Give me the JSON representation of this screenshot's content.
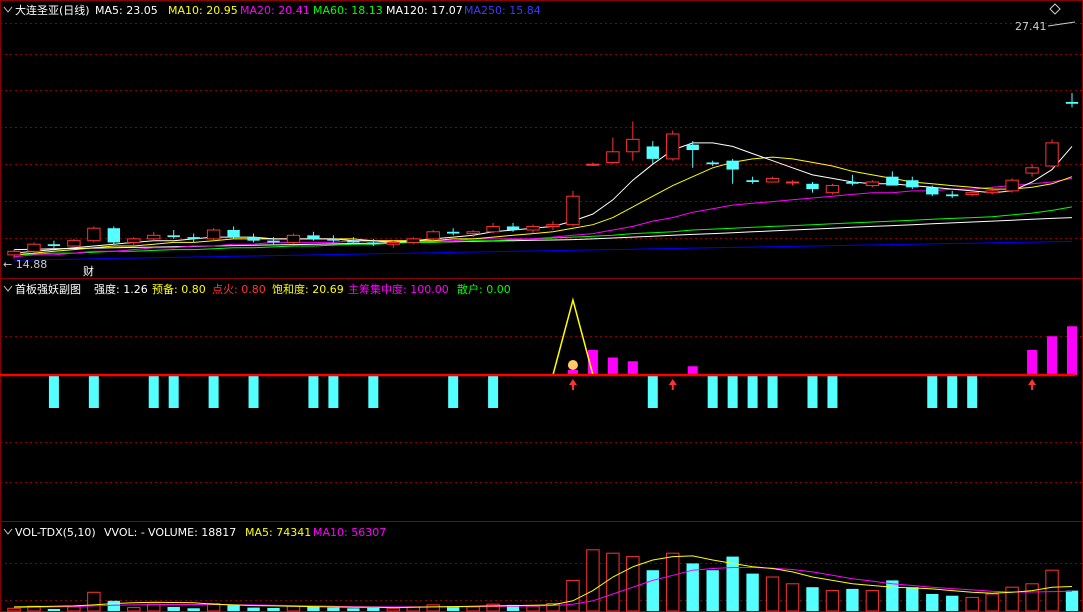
{
  "panel_main": {
    "title": "大连圣亚(日线)",
    "ma_items": [
      {
        "label": "MA5: 23.05",
        "color": "#ffffff"
      },
      {
        "label": "MA10: 20.95",
        "color": "#ffff00"
      },
      {
        "label": "MA20: 20.41",
        "color": "#ff00ff"
      },
      {
        "label": "MA60: 18.13",
        "color": "#00ff00"
      },
      {
        "label": "MA120: 17.07",
        "color": "#ffffff"
      },
      {
        "label": "MA250: 15.84",
        "color": "#0000ff"
      }
    ],
    "high_label": "27.41",
    "low_label": "← 14.88",
    "marker": "财"
  },
  "panel_indicator": {
    "title": "首板强妖副图",
    "items": [
      {
        "label": "强度: 1.26",
        "color": "#ffffff"
      },
      {
        "label": "预备: 0.80",
        "color": "#ffff00"
      },
      {
        "label": "点火: 0.80",
        "color": "#ff3333"
      },
      {
        "label": "饱和度: 20.69",
        "color": "#ffff00"
      },
      {
        "label": "主筹集中度: 100.00",
        "color": "#ff00ff"
      },
      {
        "label": "散户: 0.00",
        "color": "#00ff00"
      }
    ]
  },
  "panel_volume": {
    "title": "VOL-TDX(5,10)",
    "items": [
      {
        "label": "VVOL: -",
        "color": "#ffffff"
      },
      {
        "label": "VOLUME: 18817",
        "color": "#ffffff"
      },
      {
        "label": "MA5: 74341",
        "color": "#ffff00"
      },
      {
        "label": "MA10: 56307",
        "color": "#ff00ff"
      }
    ]
  },
  "colors": {
    "up": "#ff3232",
    "down": "#54ffff",
    "grid": "#8b0000",
    "ma5": "#ffffff",
    "ma10": "#ffff00",
    "ma20": "#ff00ff",
    "ma60": "#00ff00",
    "ma120": "#ffffff",
    "ma250": "#0000ff"
  },
  "chart_data": {
    "type": "candlestick",
    "price_range": [
      14.5,
      28.0
    ],
    "candles": [
      [
        14.9,
        15.2,
        14.7,
        15.1
      ],
      [
        15.1,
        15.6,
        15.0,
        15.5
      ],
      [
        15.5,
        15.7,
        15.3,
        15.4
      ],
      [
        15.4,
        15.8,
        15.3,
        15.7
      ],
      [
        15.7,
        16.5,
        15.6,
        16.4
      ],
      [
        16.4,
        16.5,
        15.5,
        15.6
      ],
      [
        15.6,
        15.9,
        15.4,
        15.8
      ],
      [
        15.8,
        16.2,
        15.7,
        16.0
      ],
      [
        16.0,
        16.3,
        15.8,
        15.9
      ],
      [
        15.9,
        16.1,
        15.6,
        15.8
      ],
      [
        15.8,
        16.4,
        15.7,
        16.3
      ],
      [
        16.3,
        16.5,
        15.8,
        15.9
      ],
      [
        15.9,
        16.1,
        15.6,
        15.7
      ],
      [
        15.7,
        15.9,
        15.5,
        15.6
      ],
      [
        15.6,
        16.1,
        15.5,
        16.0
      ],
      [
        16.0,
        16.2,
        15.7,
        15.8
      ],
      [
        15.8,
        16.0,
        15.6,
        15.7
      ],
      [
        15.7,
        15.9,
        15.5,
        15.6
      ],
      [
        15.6,
        15.8,
        15.4,
        15.5
      ],
      [
        15.5,
        15.7,
        15.3,
        15.6
      ],
      [
        15.6,
        15.9,
        15.5,
        15.8
      ],
      [
        15.8,
        16.3,
        15.7,
        16.2
      ],
      [
        16.2,
        16.4,
        16.0,
        16.1
      ],
      [
        16.1,
        16.3,
        15.9,
        16.2
      ],
      [
        16.2,
        16.7,
        16.1,
        16.5
      ],
      [
        16.5,
        16.7,
        16.2,
        16.3
      ],
      [
        16.3,
        16.6,
        16.1,
        16.5
      ],
      [
        16.5,
        16.8,
        16.3,
        16.6
      ],
      [
        16.6,
        18.5,
        16.5,
        18.2
      ],
      [
        20.0,
        20.1,
        19.9,
        20.0
      ],
      [
        20.1,
        21.5,
        20.0,
        20.7
      ],
      [
        20.7,
        22.4,
        20.2,
        21.4
      ],
      [
        21.0,
        21.3,
        20.0,
        20.3
      ],
      [
        20.3,
        21.9,
        20.2,
        21.7
      ],
      [
        21.1,
        21.3,
        19.8,
        20.8
      ],
      [
        20.1,
        20.2,
        19.9,
        20.0
      ],
      [
        20.2,
        20.3,
        18.9,
        19.7
      ],
      [
        19.1,
        19.3,
        18.9,
        19.0
      ],
      [
        19.0,
        19.3,
        19.0,
        19.2
      ],
      [
        19.0,
        19.1,
        18.8,
        19.0
      ],
      [
        18.9,
        19.0,
        18.4,
        18.6
      ],
      [
        18.4,
        18.9,
        18.3,
        18.8
      ],
      [
        19.0,
        19.4,
        18.8,
        18.9
      ],
      [
        18.8,
        19.1,
        18.7,
        19.0
      ],
      [
        19.3,
        19.6,
        18.8,
        18.8
      ],
      [
        19.1,
        19.3,
        18.6,
        18.7
      ],
      [
        18.7,
        18.8,
        18.2,
        18.3
      ],
      [
        18.3,
        18.5,
        18.1,
        18.2
      ],
      [
        18.3,
        18.4,
        18.2,
        18.4
      ],
      [
        18.4,
        18.7,
        18.3,
        18.5
      ],
      [
        18.5,
        19.2,
        18.4,
        19.1
      ],
      [
        19.5,
        20.0,
        19.3,
        19.8
      ],
      [
        19.9,
        21.4,
        19.8,
        21.2
      ],
      [
        23.5,
        24.0,
        23.2,
        23.4
      ]
    ],
    "ma5": [
      15.0,
      15.1,
      15.2,
      15.3,
      15.4,
      15.5,
      15.6,
      15.7,
      15.7,
      15.8,
      15.9,
      15.9,
      15.9,
      15.8,
      15.8,
      15.8,
      15.8,
      15.7,
      15.7,
      15.6,
      15.7,
      15.8,
      15.9,
      16.0,
      16.2,
      16.3,
      16.4,
      16.5,
      16.8,
      17.2,
      18.0,
      19.1,
      20.0,
      20.8,
      21.2,
      21.2,
      21.0,
      20.6,
      20.2,
      19.8,
      19.4,
      19.2,
      19.0,
      18.9,
      18.9,
      18.8,
      18.7,
      18.6,
      18.5,
      18.4,
      18.5,
      19.0,
      19.7,
      21.0
    ],
    "ma10": [
      14.9,
      15.0,
      15.1,
      15.2,
      15.3,
      15.4,
      15.4,
      15.5,
      15.6,
      15.6,
      15.7,
      15.8,
      15.8,
      15.8,
      15.8,
      15.8,
      15.8,
      15.8,
      15.7,
      15.7,
      15.7,
      15.7,
      15.8,
      15.8,
      15.9,
      16.0,
      16.1,
      16.2,
      16.4,
      16.6,
      17.0,
      17.6,
      18.2,
      18.8,
      19.3,
      19.8,
      20.1,
      20.3,
      20.4,
      20.3,
      20.1,
      19.9,
      19.6,
      19.4,
      19.2,
      19.0,
      18.9,
      18.8,
      18.7,
      18.6,
      18.6,
      18.7,
      18.9,
      19.3
    ],
    "ma20": [
      14.8,
      14.9,
      14.9,
      15.0,
      15.1,
      15.1,
      15.2,
      15.3,
      15.3,
      15.4,
      15.4,
      15.5,
      15.5,
      15.6,
      15.6,
      15.6,
      15.6,
      15.7,
      15.7,
      15.7,
      15.7,
      15.7,
      15.7,
      15.8,
      15.8,
      15.8,
      15.8,
      15.9,
      16.0,
      16.1,
      16.3,
      16.5,
      16.8,
      17.0,
      17.3,
      17.5,
      17.7,
      17.8,
      17.9,
      18.0,
      18.1,
      18.2,
      18.3,
      18.4,
      18.4,
      18.5,
      18.5,
      18.6,
      18.6,
      18.7,
      18.8,
      18.9,
      19.0,
      19.2
    ],
    "ma60": [
      14.9,
      14.95,
      15.0,
      15.0,
      15.05,
      15.1,
      15.1,
      15.15,
      15.2,
      15.2,
      15.25,
      15.3,
      15.3,
      15.35,
      15.4,
      15.4,
      15.45,
      15.5,
      15.5,
      15.55,
      15.6,
      15.6,
      15.65,
      15.7,
      15.7,
      15.75,
      15.8,
      15.85,
      15.9,
      15.95,
      16.0,
      16.1,
      16.15,
      16.2,
      16.3,
      16.35,
      16.4,
      16.45,
      16.5,
      16.55,
      16.6,
      16.65,
      16.7,
      16.75,
      16.8,
      16.85,
      16.9,
      16.95,
      17.0,
      17.05,
      17.15,
      17.25,
      17.4,
      17.6
    ],
    "ma120": [
      15.2,
      15.22,
      15.24,
      15.26,
      15.28,
      15.3,
      15.32,
      15.34,
      15.36,
      15.38,
      15.4,
      15.42,
      15.44,
      15.46,
      15.48,
      15.5,
      15.52,
      15.54,
      15.56,
      15.58,
      15.6,
      15.62,
      15.64,
      15.66,
      15.68,
      15.7,
      15.72,
      15.74,
      15.76,
      15.8,
      15.85,
      15.9,
      15.95,
      16.0,
      16.05,
      16.1,
      16.15,
      16.2,
      16.25,
      16.3,
      16.35,
      16.4,
      16.45,
      16.5,
      16.55,
      16.6,
      16.65,
      16.7,
      16.75,
      16.8,
      16.85,
      16.9,
      16.95,
      17.0
    ],
    "ma250": [
      14.6,
      14.62,
      14.64,
      14.66,
      14.68,
      14.7,
      14.72,
      14.74,
      14.76,
      14.78,
      14.8,
      14.82,
      14.84,
      14.86,
      14.88,
      14.9,
      14.92,
      14.94,
      14.96,
      14.98,
      15.0,
      15.02,
      15.04,
      15.06,
      15.08,
      15.1,
      15.12,
      15.14,
      15.16,
      15.18,
      15.2,
      15.22,
      15.24,
      15.26,
      15.28,
      15.3,
      15.32,
      15.34,
      15.36,
      15.38,
      15.4,
      15.42,
      15.44,
      15.46,
      15.48,
      15.5,
      15.52,
      15.54,
      15.56,
      15.58,
      15.6,
      15.62,
      15.64,
      15.66
    ],
    "indicator_bars": [
      0,
      0,
      -1,
      0,
      -1,
      0,
      0,
      -1,
      -1,
      0,
      -1,
      0,
      -1,
      0,
      0,
      -1,
      -1,
      0,
      -1,
      0,
      0,
      0,
      -1,
      0,
      -1,
      0,
      0,
      0,
      0.2,
      1.0,
      0.7,
      0.55,
      -1,
      0,
      0.35,
      -1,
      -1,
      -1,
      -1,
      0,
      -1,
      -1,
      0,
      0,
      0,
      0,
      -1,
      -1,
      -1,
      0,
      0,
      1.0,
      1.55,
      1.95
    ],
    "indicator_spike_index": 28,
    "indicator_arrow_indices": [
      28,
      33,
      51
    ],
    "volume": [
      8,
      14,
      6,
      12,
      55,
      30,
      10,
      20,
      12,
      8,
      22,
      18,
      10,
      9,
      14,
      12,
      10,
      8,
      9,
      8,
      12,
      18,
      14,
      12,
      20,
      18,
      14,
      22,
      90,
      180,
      170,
      160,
      120,
      170,
      140,
      120,
      160,
      110,
      100,
      80,
      70,
      60,
      65,
      60,
      90,
      70,
      50,
      45,
      40,
      50,
      70,
      80,
      120,
      60
    ],
    "volume_ma5": [
      12,
      13,
      14,
      15,
      18,
      22,
      24,
      26,
      25,
      24,
      20,
      18,
      16,
      15,
      14,
      13,
      12,
      11,
      11,
      10,
      11,
      12,
      13,
      14,
      15,
      16,
      17,
      18,
      30,
      60,
      100,
      130,
      150,
      160,
      162,
      150,
      140,
      130,
      125,
      115,
      100,
      90,
      80,
      75,
      70,
      68,
      65,
      60,
      55,
      52,
      55,
      60,
      70,
      72
    ],
    "volume_ma10": [
      10,
      11,
      12,
      13,
      15,
      17,
      18,
      19,
      19,
      19,
      19,
      18,
      18,
      17,
      16,
      15,
      14,
      13,
      12,
      12,
      12,
      12,
      12,
      13,
      13,
      14,
      15,
      16,
      20,
      30,
      50,
      70,
      90,
      105,
      120,
      125,
      128,
      128,
      126,
      122,
      115,
      105,
      95,
      88,
      80,
      75,
      70,
      66,
      62,
      58,
      56,
      56,
      57,
      58
    ],
    "volume_max": 200
  }
}
